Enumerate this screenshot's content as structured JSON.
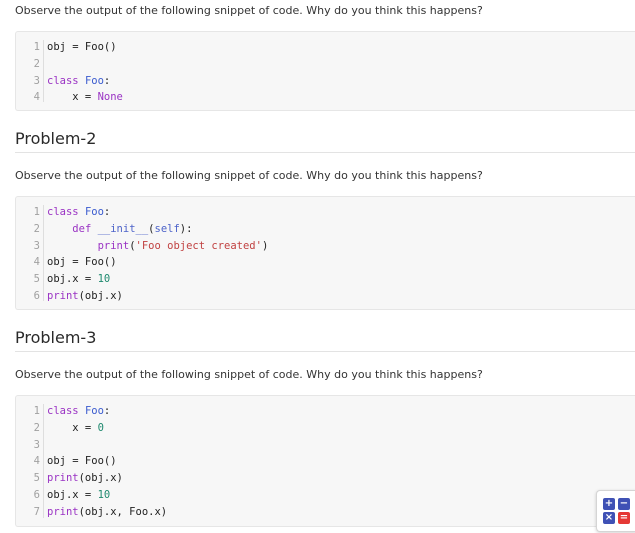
{
  "problem1": {
    "description": "Observe the output of the following snippet of code. Why do you think this happens?",
    "code": [
      {
        "n": "1",
        "tokens": [
          [
            "t",
            "obj = Foo()"
          ]
        ]
      },
      {
        "n": "2",
        "tokens": []
      },
      {
        "n": "3",
        "tokens": [
          [
            "kw",
            "class "
          ],
          [
            "cls",
            "Foo"
          ],
          [
            "t",
            ":"
          ]
        ]
      },
      {
        "n": "4",
        "tokens": [
          [
            "t",
            "    x = "
          ],
          [
            "none",
            "None"
          ]
        ]
      }
    ]
  },
  "problem2": {
    "title": "Problem-2",
    "description": "Observe the output of the following snippet of code. Why do you think this happens?",
    "code": [
      {
        "n": "1",
        "tokens": [
          [
            "kw",
            "class "
          ],
          [
            "cls",
            "Foo"
          ],
          [
            "t",
            ":"
          ]
        ]
      },
      {
        "n": "2",
        "tokens": [
          [
            "t",
            "    "
          ],
          [
            "kw",
            "def "
          ],
          [
            "fn",
            "__init__"
          ],
          [
            "t",
            "("
          ],
          [
            "fn",
            "self"
          ],
          [
            "t",
            "):"
          ]
        ]
      },
      {
        "n": "3",
        "tokens": [
          [
            "t",
            "        "
          ],
          [
            "kw",
            "print"
          ],
          [
            "t",
            "("
          ],
          [
            "str",
            "'Foo object created'"
          ],
          [
            "t",
            ")"
          ]
        ]
      },
      {
        "n": "4",
        "tokens": [
          [
            "t",
            "obj = Foo()"
          ]
        ]
      },
      {
        "n": "5",
        "tokens": [
          [
            "t",
            "obj.x = "
          ],
          [
            "num",
            "10"
          ]
        ]
      },
      {
        "n": "6",
        "tokens": [
          [
            "kw",
            "print"
          ],
          [
            "t",
            "(obj.x)"
          ]
        ]
      }
    ]
  },
  "problem3": {
    "title": "Problem-3",
    "description": "Observe the output of the following snippet of code. Why do you think this happens?",
    "code": [
      {
        "n": "1",
        "tokens": [
          [
            "kw",
            "class "
          ],
          [
            "cls",
            "Foo"
          ],
          [
            "t",
            ":"
          ]
        ]
      },
      {
        "n": "2",
        "tokens": [
          [
            "t",
            "    x = "
          ],
          [
            "num",
            "0"
          ]
        ]
      },
      {
        "n": "3",
        "tokens": []
      },
      {
        "n": "4",
        "tokens": [
          [
            "t",
            "obj = Foo()"
          ]
        ]
      },
      {
        "n": "5",
        "tokens": [
          [
            "kw",
            "print"
          ],
          [
            "t",
            "(obj.x)"
          ]
        ]
      },
      {
        "n": "6",
        "tokens": [
          [
            "t",
            "obj.x = "
          ],
          [
            "num",
            "10"
          ]
        ]
      },
      {
        "n": "7",
        "tokens": [
          [
            "kw",
            "print"
          ],
          [
            "t",
            "(obj.x, Foo.x)"
          ]
        ]
      }
    ]
  },
  "widget": {
    "icon": "calculator-icon",
    "colors": {
      "blue": "#3f51b5",
      "red": "#e53935"
    },
    "glyphs": [
      "+",
      "−",
      "×",
      "="
    ]
  }
}
